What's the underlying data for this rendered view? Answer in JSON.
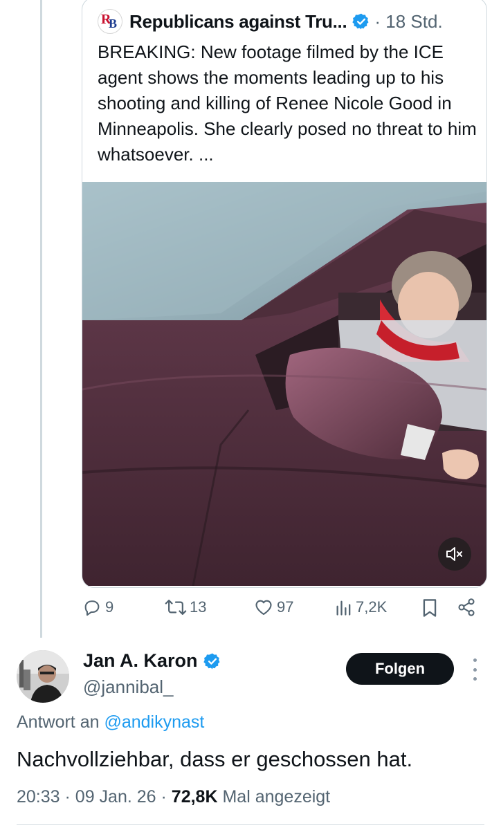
{
  "quoted_tweet": {
    "author_name": "Republicans against Tru...",
    "avatar_text": {
      "first": "R",
      "second": "B"
    },
    "timestamp": "· 18 Std.",
    "text": "BREAKING: New footage filmed by the ICE agent shows the moments leading up to his shooting and killing of Renee Nicole Good in Minneapolis. She clearly posed no threat to him whatsoever. ...",
    "media_icon": "muted-speaker-icon",
    "verified_color": "#1d9bf0"
  },
  "actions": {
    "replies": "9",
    "reposts": "13",
    "likes": "97",
    "views": "7,2K"
  },
  "reply": {
    "author_name": "Jan A. Karon",
    "handle": "@jannibal_",
    "follow_label": "Folgen",
    "reply_to_prefix": "Antwort an",
    "reply_to_mention": "@andikynast",
    "text": "Nachvollziehbar, dass er geschossen hat.",
    "time": "20:33",
    "date": "09 Jan. 26",
    "view_count": "72,8K",
    "view_suffix": "Mal angezeigt",
    "separator": "·"
  },
  "colors": {
    "accent": "#1d9bf0",
    "text_primary": "#0f1419",
    "text_secondary": "#536471",
    "border": "#cfd9de"
  }
}
